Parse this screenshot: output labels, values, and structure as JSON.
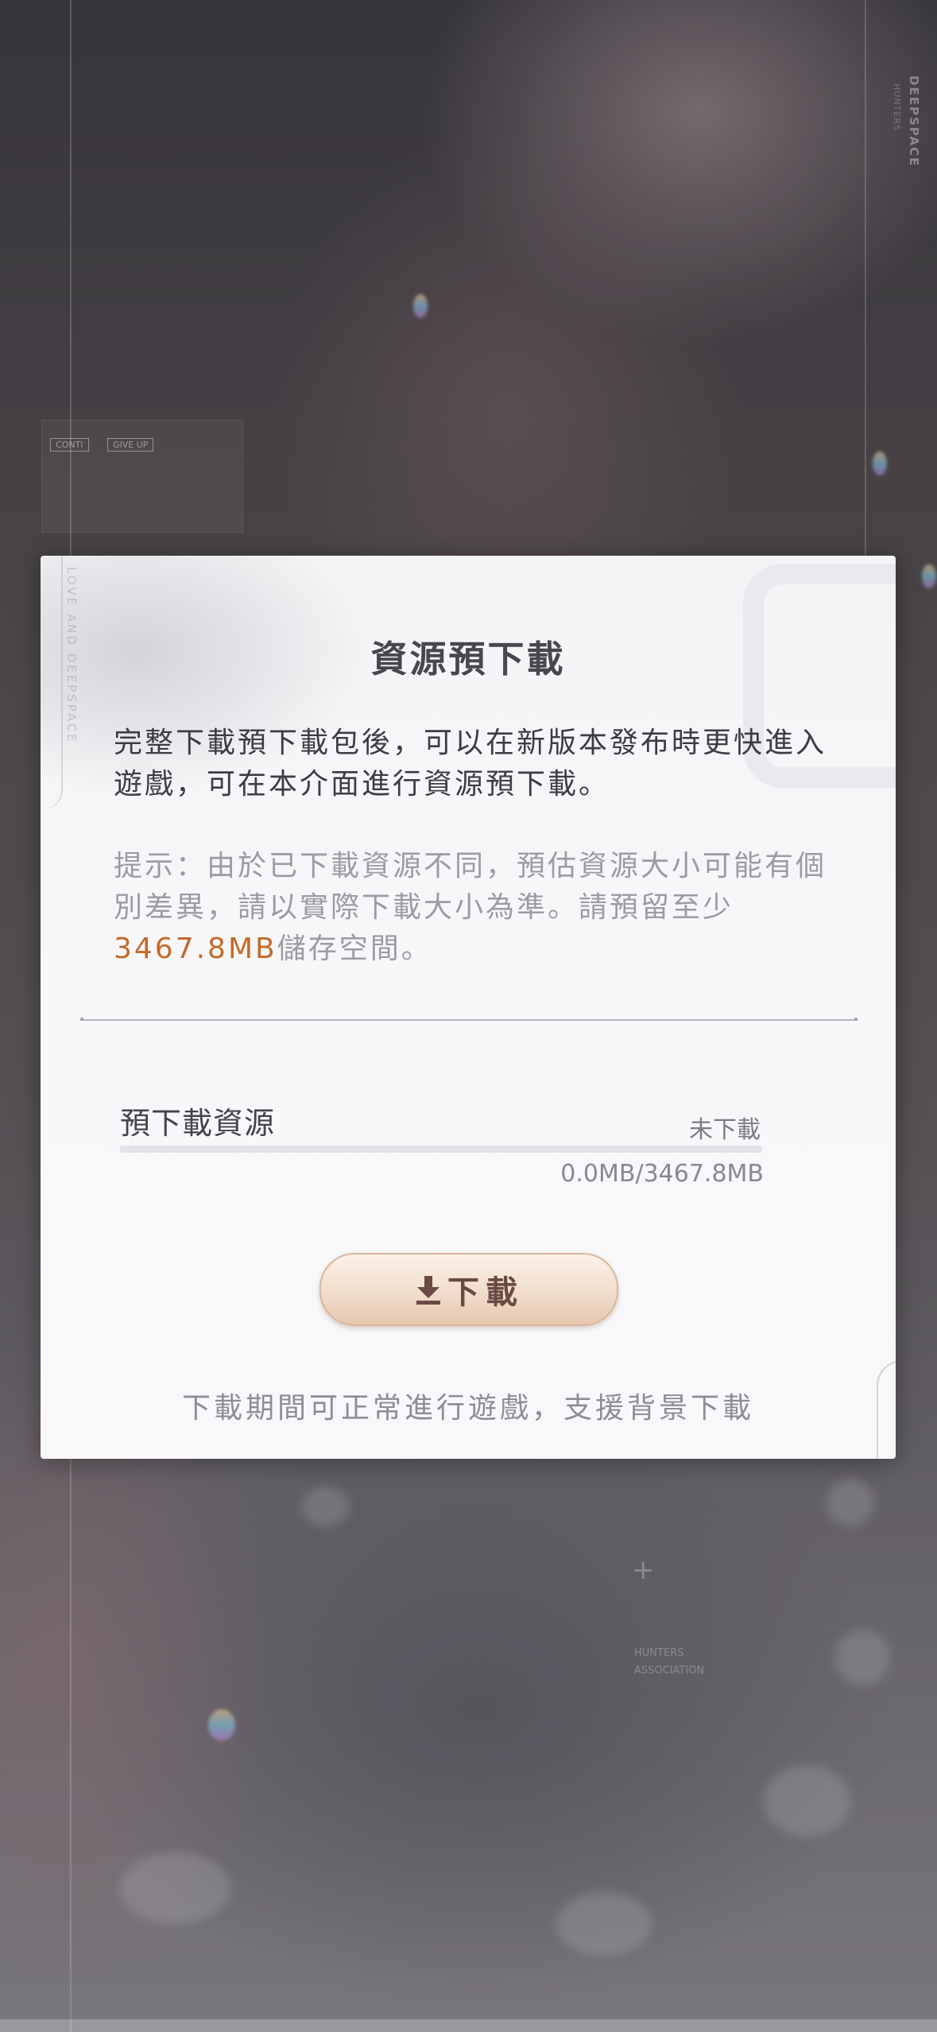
{
  "background": {
    "brand_vertical": "DEEPSPACE",
    "brand_vertical_sub": "HUNTERS",
    "panel_chip_1": "CONTI",
    "panel_chip_2": "GIVE UP",
    "association_line_1": "HUNTERS",
    "association_line_2": "ASSOCIATION"
  },
  "dialog": {
    "deco_vertical_text": "LOVE AND DEEPSPACE",
    "title": "資源預下載",
    "description": "完整下載預下載包後，可以在新版本發布時更快進入遊戲，可在本介面進行資源預下載。",
    "hint_prefix": "提示：由於已下載資源不同，預估資源大小可能有個別差異，請以實際下載大小為準。請預留至少",
    "hint_size": "3467.8MB",
    "hint_suffix": "儲存空間。",
    "resource": {
      "label": "預下載資源",
      "status": "未下載",
      "size_text": "0.0MB/3467.8MB",
      "progress": 0
    },
    "download_button": {
      "label": "下載",
      "icon": "download-icon"
    },
    "footer_note": "下載期間可正常進行遊戲，支援背景下載"
  },
  "colors": {
    "accent_size": "#c46a2a",
    "button_text": "#6a4a44",
    "title": "#4a4650"
  }
}
